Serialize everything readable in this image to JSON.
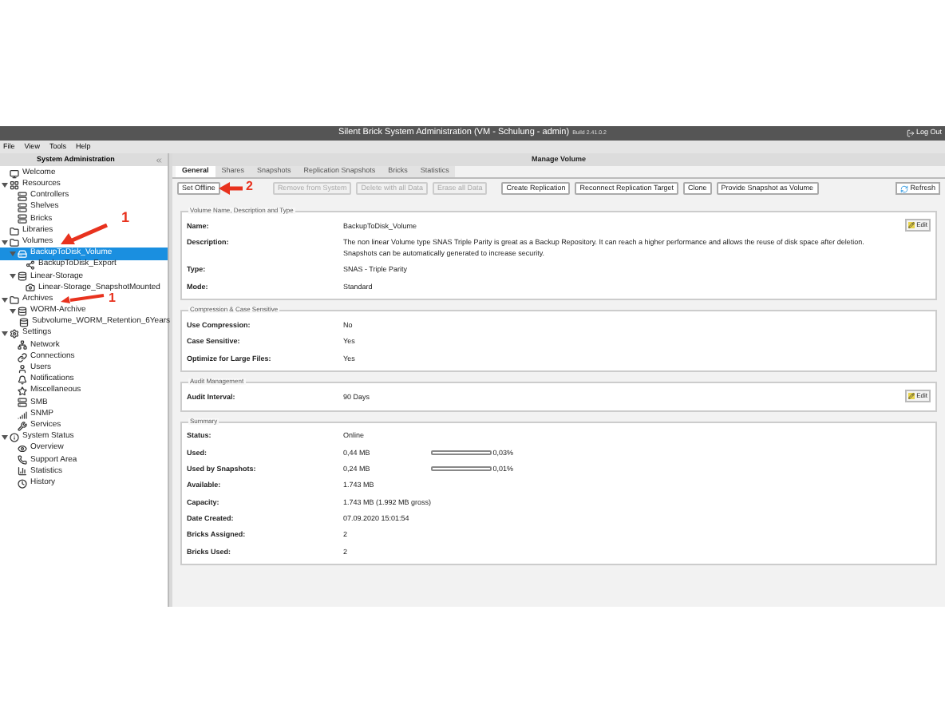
{
  "window": {
    "title": "Silent Brick System Administration (VM - Schulung - admin)",
    "build": "Build 2.41.0.2",
    "logout": "Log Out"
  },
  "menu": [
    "File",
    "View",
    "Tools",
    "Help"
  ],
  "sidebar": {
    "title": "System Administration",
    "items": [
      {
        "label": "Welcome",
        "kind": "welcome",
        "selected": false
      },
      {
        "label": "Resources",
        "kind": "grid",
        "selected": false,
        "expanded": true,
        "children": [
          {
            "label": "Controllers",
            "kind": "server",
            "selected": false
          },
          {
            "label": "Shelves",
            "kind": "server",
            "selected": false
          },
          {
            "label": "Bricks",
            "kind": "server",
            "selected": false
          }
        ]
      },
      {
        "label": "Libraries",
        "kind": "folder",
        "selected": false
      },
      {
        "label": "Volumes",
        "kind": "folder",
        "selected": false,
        "expanded": true,
        "children": [
          {
            "label": "BackupToDisk_Volume",
            "kind": "volume",
            "selected": true,
            "expanded": true,
            "children": [
              {
                "label": "BackupToDisk_Export",
                "kind": "export",
                "selected": false
              }
            ]
          },
          {
            "label": "Linear-Storage",
            "kind": "storage",
            "selected": false,
            "expanded": true,
            "children": [
              {
                "label": "Linear-Storage_SnapshotMounted",
                "kind": "snapshot",
                "selected": false
              }
            ]
          }
        ]
      },
      {
        "label": "Archives",
        "kind": "folder",
        "selected": false,
        "expanded": true,
        "children": [
          {
            "label": "WORM-Archive",
            "kind": "storage",
            "selected": false,
            "expanded": true,
            "children": [
              {
                "label": "Subvolume_WORM_Retention_6Years",
                "kind": "storage",
                "selected": false
              }
            ]
          }
        ]
      },
      {
        "label": "Settings",
        "kind": "gear",
        "selected": false,
        "expanded": true,
        "children": [
          {
            "label": "Network",
            "kind": "network",
            "selected": false
          },
          {
            "label": "Connections",
            "kind": "link",
            "selected": false
          },
          {
            "label": "Users",
            "kind": "user",
            "selected": false
          },
          {
            "label": "Notifications",
            "kind": "bell",
            "selected": false
          },
          {
            "label": "Miscellaneous",
            "kind": "star",
            "selected": false
          },
          {
            "label": "SMB",
            "kind": "server",
            "selected": false
          },
          {
            "label": "SNMP",
            "kind": "signal",
            "selected": false
          },
          {
            "label": "Services",
            "kind": "wrench",
            "selected": false
          }
        ]
      },
      {
        "label": "System Status",
        "kind": "info",
        "selected": false,
        "expanded": true,
        "children": [
          {
            "label": "Overview",
            "kind": "eye",
            "selected": false
          },
          {
            "label": "Support Area",
            "kind": "phone",
            "selected": false
          },
          {
            "label": "Statistics",
            "kind": "chart",
            "selected": false
          },
          {
            "label": "History",
            "kind": "clock",
            "selected": false
          }
        ]
      }
    ]
  },
  "main": {
    "title": "Manage Volume",
    "tabs": [
      {
        "label": "General",
        "selected": true
      },
      {
        "label": "Shares",
        "selected": false
      },
      {
        "label": "Snapshots",
        "selected": false
      },
      {
        "label": "Replication Snapshots",
        "selected": false
      },
      {
        "label": "Bricks",
        "selected": false
      },
      {
        "label": "Statistics",
        "selected": false
      }
    ],
    "toolbar": [
      {
        "label": "Set Offline",
        "disabled": false
      },
      {
        "label": "Remove from System",
        "disabled": true
      },
      {
        "label": "Delete with all Data",
        "disabled": true
      },
      {
        "label": "Erase all Data",
        "disabled": true
      },
      {
        "label": "Create Replication",
        "disabled": false
      },
      {
        "label": "Reconnect Replication Target",
        "disabled": false
      },
      {
        "label": "Clone",
        "disabled": false
      },
      {
        "label": "Provide Snapshot as Volume",
        "disabled": false
      }
    ],
    "refresh": "Refresh",
    "sections": [
      {
        "title": "Volume Name, Description and Type",
        "edit": "Edit",
        "rows": [
          {
            "label": "Name:",
            "value": "BackupToDisk_Volume"
          },
          {
            "label": "Description:",
            "value": "The non linear Volume type SNAS Triple Parity is great as a Backup Repository. It can reach a higher performance and allows the reuse of disk space after deletion. Snapshots can be automatically generated to increase security."
          },
          {
            "label": "Type:",
            "value": "SNAS - Triple Parity"
          },
          {
            "label": "Mode:",
            "value": "Standard"
          }
        ]
      },
      {
        "title": "Compression & Case Sensitive",
        "rows": [
          {
            "label": "Use Compression:",
            "value": "No"
          },
          {
            "label": "Case Sensitive:",
            "value": "Yes"
          },
          {
            "label": "Optimize for Large Files:",
            "value": "Yes"
          }
        ]
      },
      {
        "title": "Audit Management",
        "edit": "Edit",
        "rows": [
          {
            "label": "Audit Interval:",
            "value": "90 Days"
          }
        ]
      },
      {
        "title": "Summary",
        "rows": [
          {
            "label": "Status:",
            "value": "Online"
          },
          {
            "label": "Used:",
            "value": "0,44 MB",
            "level": 0.0003,
            "reading": "0,03%"
          },
          {
            "label": "Used by Snapshots:",
            "value": "0,24 MB",
            "level": 0.0001,
            "reading": "0,01%"
          },
          {
            "label": "Available:",
            "value": "1.743 MB"
          },
          {
            "label": "Capacity:",
            "value": "1.743 MB (1.992 MB gross)"
          },
          {
            "label": "Date Created:",
            "value": "07.09.2020 15:01:54"
          },
          {
            "label": "Bricks Assigned:",
            "value": "2"
          },
          {
            "label": "Bricks Used:",
            "value": "2"
          }
        ]
      }
    ]
  },
  "annotations": [
    {
      "label": "1"
    },
    {
      "label": "1"
    },
    {
      "label": "2"
    }
  ]
}
